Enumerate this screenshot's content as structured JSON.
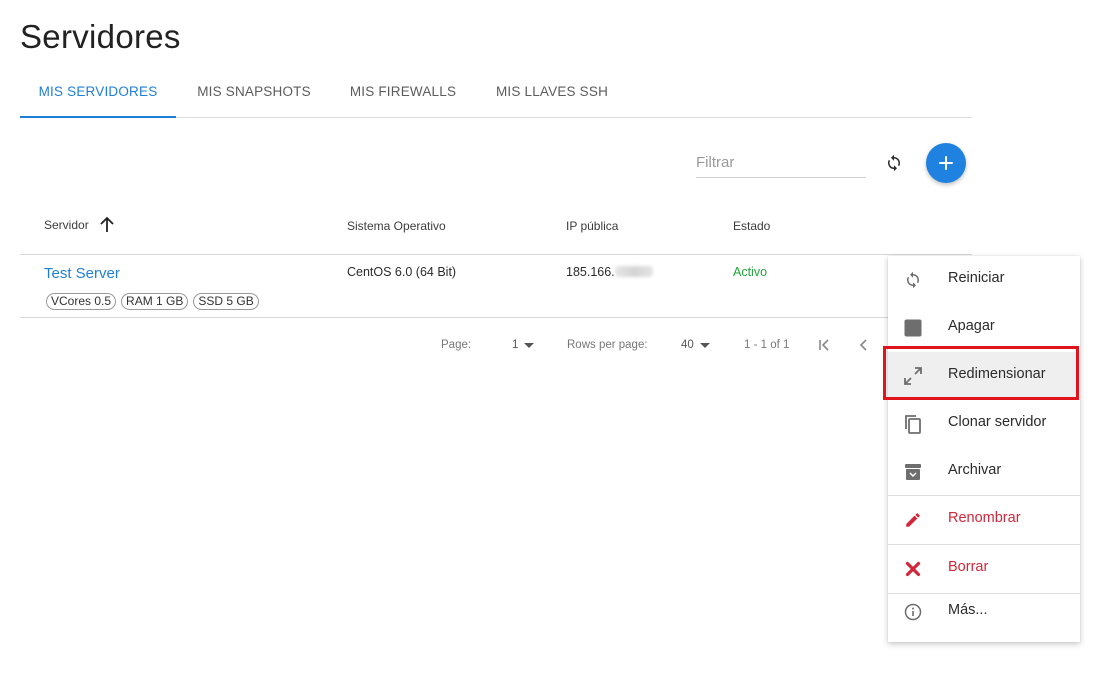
{
  "page": {
    "title": "Servidores"
  },
  "tabs": [
    {
      "label": "MIS SERVIDORES",
      "active": true
    },
    {
      "label": "MIS SNAPSHOTS",
      "active": false
    },
    {
      "label": "MIS FIREWALLS",
      "active": false
    },
    {
      "label": "MIS LLAVES SSH",
      "active": false
    }
  ],
  "toolbar": {
    "filter_placeholder": "Filtrar",
    "refresh_icon": "refresh-icon",
    "add_icon": "plus-icon",
    "accent_color": "#1f82e0"
  },
  "table": {
    "columns": {
      "server": "Servidor",
      "os": "Sistema Operativo",
      "ip": "IP pública",
      "status": "Estado"
    },
    "sort_icon": "arrow-up-icon",
    "rows": [
      {
        "name": "Test Server",
        "chips": [
          "VCores 0.5",
          "RAM 1 GB",
          "SSD 5 GB"
        ],
        "os": "CentOS 6.0 (64 Bit)",
        "ip_visible": "185.166.",
        "status": "Activo",
        "status_color": "#22a33a"
      }
    ]
  },
  "pagination": {
    "page_label": "Page:",
    "page_value": "1",
    "rows_label": "Rows per page:",
    "rows_value": "40",
    "range": "1 - 1 of 1"
  },
  "context_menu": {
    "items": [
      {
        "label": "Reiniciar",
        "icon": "restart-icon",
        "danger": false
      },
      {
        "label": "Apagar",
        "icon": "stop-icon",
        "danger": false
      },
      {
        "label": "Redimensionar",
        "icon": "resize-icon",
        "danger": false,
        "highlighted": true
      },
      {
        "label": "Clonar servidor",
        "icon": "copy-icon",
        "danger": false
      },
      {
        "label": "Archivar",
        "icon": "archive-icon",
        "danger": false
      },
      {
        "label": "Renombrar",
        "icon": "pencil-icon",
        "danger": true
      },
      {
        "label": "Borrar",
        "icon": "delete-x-icon",
        "danger": true
      },
      {
        "label": "Más...",
        "icon": "info-icon",
        "danger": false
      }
    ],
    "danger_color": "#d0283a",
    "highlight_color": "#e0141c"
  }
}
